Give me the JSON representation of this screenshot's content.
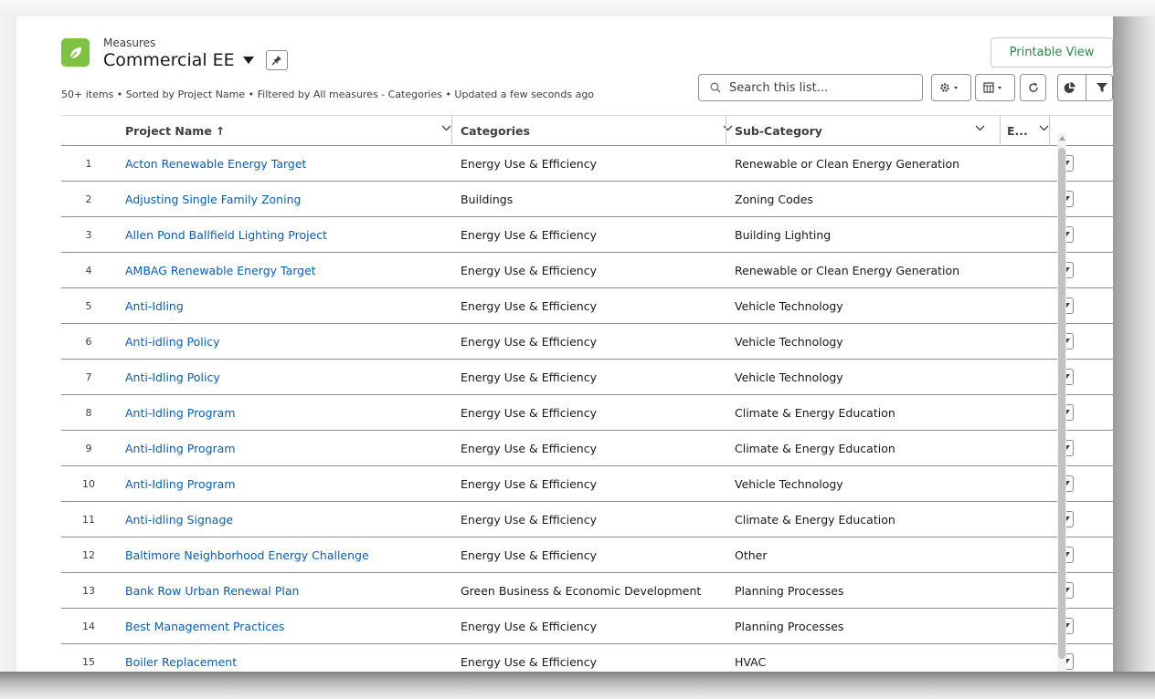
{
  "header": {
    "object_label": "Measures",
    "list_title": "Commercial EE",
    "meta": "50+ items • Sorted by Project Name • Filtered by All measures - Categories • Updated a few seconds ago",
    "printable_view_label": "Printable View",
    "search_placeholder": "Search this list..."
  },
  "icons": {
    "app": "leaf-icon",
    "title_dropdown": "caret-down-icon",
    "pin": "pin-icon",
    "search": "search-icon",
    "settings": "gear-icon",
    "display_as": "table-icon",
    "refresh": "refresh-icon",
    "charts": "chart-icon",
    "filter": "filter-icon",
    "row_action": "chevron-down-icon"
  },
  "colors": {
    "app_icon": "#7fc242",
    "link": "#0b5cab",
    "printable_view_text": "#2e844a"
  },
  "table": {
    "columns": {
      "project_name": "Project Name",
      "categories": "Categories",
      "sub_category": "Sub-Category",
      "e_col": "E..."
    },
    "sort_indicator": "↑",
    "rows": [
      {
        "num": "1",
        "name": "Acton Renewable Energy Target",
        "category": "Energy Use & Efficiency",
        "sub": "Renewable or Clean Energy Generation"
      },
      {
        "num": "2",
        "name": "Adjusting Single Family Zoning",
        "category": "Buildings",
        "sub": "Zoning Codes"
      },
      {
        "num": "3",
        "name": "Allen Pond Ballfield Lighting Project",
        "category": "Energy Use & Efficiency",
        "sub": "Building Lighting"
      },
      {
        "num": "4",
        "name": "AMBAG Renewable Energy Target",
        "category": "Energy Use & Efficiency",
        "sub": "Renewable or Clean Energy Generation"
      },
      {
        "num": "5",
        "name": "Anti-Idling",
        "category": "Energy Use & Efficiency",
        "sub": "Vehicle Technology"
      },
      {
        "num": "6",
        "name": "Anti-idling Policy",
        "category": "Energy Use & Efficiency",
        "sub": "Vehicle Technology"
      },
      {
        "num": "7",
        "name": "Anti-Idling Policy",
        "category": "Energy Use & Efficiency",
        "sub": "Vehicle Technology"
      },
      {
        "num": "8",
        "name": "Anti-Idling Program",
        "category": "Energy Use & Efficiency",
        "sub": "Climate & Energy Education"
      },
      {
        "num": "9",
        "name": "Anti-Idling Program",
        "category": "Energy Use & Efficiency",
        "sub": "Climate & Energy Education"
      },
      {
        "num": "10",
        "name": "Anti-Idling Program",
        "category": "Energy Use & Efficiency",
        "sub": "Vehicle Technology"
      },
      {
        "num": "11",
        "name": "Anti-idling Signage",
        "category": "Energy Use & Efficiency",
        "sub": "Climate & Energy Education"
      },
      {
        "num": "12",
        "name": "Baltimore Neighborhood Energy Challenge",
        "category": "Energy Use & Efficiency",
        "sub": "Other"
      },
      {
        "num": "13",
        "name": "Bank Row Urban Renewal Plan",
        "category": "Green Business & Economic Development",
        "sub": "Planning Processes"
      },
      {
        "num": "14",
        "name": "Best Management Practices",
        "category": "Energy Use & Efficiency",
        "sub": "Planning Processes"
      },
      {
        "num": "15",
        "name": "Boiler Replacement",
        "category": "Energy Use & Efficiency",
        "sub": "HVAC"
      }
    ]
  }
}
